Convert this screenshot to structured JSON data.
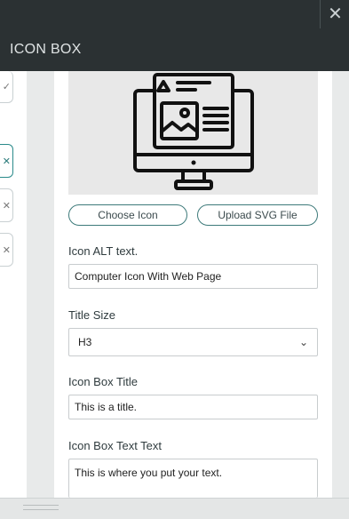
{
  "window": {
    "close_glyph": "✕"
  },
  "header": {
    "title": "ICON BOX"
  },
  "left_strip": {
    "items": [
      {
        "glyph": "✓",
        "active": false
      },
      {
        "glyph": "✕",
        "active": true
      },
      {
        "glyph": "✕",
        "active": false
      },
      {
        "glyph": "✕",
        "active": false
      }
    ]
  },
  "icon_preview": {
    "icon": "computer-monitor-web-page-icon"
  },
  "buttons": {
    "choose_icon": "Choose Icon",
    "upload_svg": "Upload SVG File"
  },
  "fields": {
    "alt_text": {
      "label": "Icon ALT text.",
      "value": "Computer Icon With Web Page"
    },
    "title_size": {
      "label": "Title Size",
      "value": "H3"
    },
    "box_title": {
      "label": "Icon Box Title",
      "value": "This is a title."
    },
    "box_text": {
      "label": "Icon Box Text Text",
      "value": "This is where you put your text."
    }
  },
  "colors": {
    "header_bg": "#2b3133",
    "accent": "#3d7a7a"
  }
}
